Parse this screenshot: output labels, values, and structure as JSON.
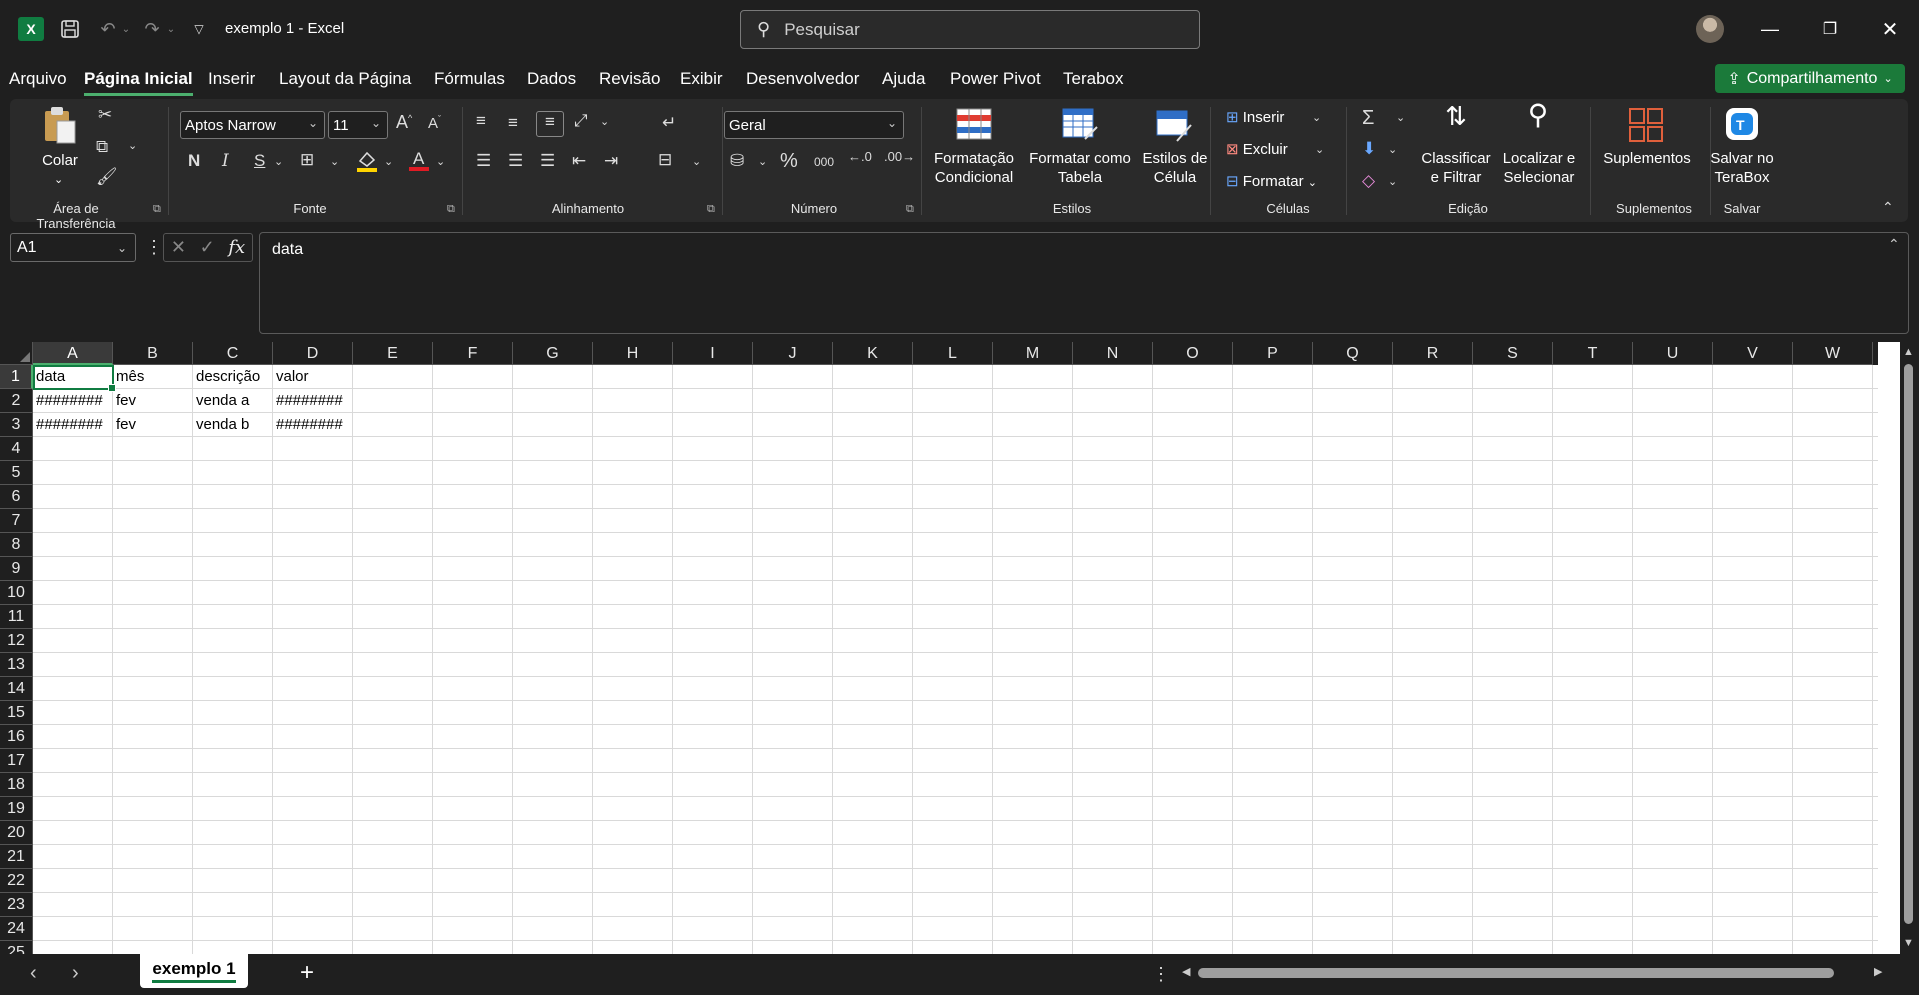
{
  "window": {
    "title": "exemplo 1  -  Excel",
    "logo_letter": "X",
    "search_placeholder": "Pesquisar"
  },
  "menu": [
    {
      "label": "Arquivo"
    },
    {
      "label": "Página Inicial",
      "active": true
    },
    {
      "label": "Inserir"
    },
    {
      "label": "Layout da Página"
    },
    {
      "label": "Fórmulas"
    },
    {
      "label": "Dados"
    },
    {
      "label": "Revisão"
    },
    {
      "label": "Exibir"
    },
    {
      "label": "Desenvolvedor"
    },
    {
      "label": "Ajuda"
    },
    {
      "label": "Power Pivot"
    },
    {
      "label": "Terabox"
    }
  ],
  "share_label": "Compartilhamento",
  "ribbon": {
    "clipboard": {
      "paste_label": "Colar",
      "group": "Área de Transferência"
    },
    "font": {
      "name": "Aptos Narrow",
      "size": "11",
      "bold": "N",
      "italic": "I",
      "underline": "S",
      "group": "Fonte"
    },
    "alignment": {
      "group": "Alinhamento"
    },
    "number": {
      "format": "Geral",
      "percent": "%",
      "thousands": "000",
      "group": "Número"
    },
    "styles": {
      "conditional_l1": "Formatação",
      "conditional_l2": "Condicional",
      "table_l1": "Formatar como",
      "table_l2": "Tabela",
      "cellstyles_l1": "Estilos de",
      "cellstyles_l2": "Célula",
      "group": "Estilos"
    },
    "cells": {
      "insert": "Inserir",
      "delete": "Excluir",
      "format": "Formatar",
      "group": "Células"
    },
    "editing": {
      "sort_l1": "Classificar",
      "sort_l2": "e Filtrar",
      "find_l1": "Localizar e",
      "find_l2": "Selecionar",
      "group": "Edição"
    },
    "addins": {
      "label": "Suplementos",
      "group": "Suplementos"
    },
    "save": {
      "l1": "Salvar no",
      "l2": "TeraBox",
      "group": "Salvar"
    }
  },
  "formula_bar": {
    "name_box": "A1",
    "content": "data"
  },
  "columns": [
    "A",
    "B",
    "C",
    "D",
    "E",
    "F",
    "G",
    "H",
    "I",
    "J",
    "K",
    "L",
    "M",
    "N",
    "O",
    "P",
    "Q",
    "R",
    "S",
    "T",
    "U",
    "V",
    "W"
  ],
  "rows": [
    "1",
    "2",
    "3",
    "4",
    "5",
    "6",
    "7",
    "8",
    "9",
    "10",
    "11",
    "12",
    "13",
    "14",
    "15",
    "16",
    "17",
    "18",
    "19",
    "20",
    "21",
    "22",
    "23",
    "24",
    "25"
  ],
  "cells": [
    [
      "data",
      "mês",
      "descrição",
      "valor"
    ],
    [
      "########",
      "fev",
      "venda a",
      "########"
    ],
    [
      "########",
      "fev",
      "venda b",
      "########"
    ]
  ],
  "sheet_tab": "exemplo 1",
  "colors": {
    "accent": "#107c41",
    "share": "#1b7a3a",
    "chrome": "#1f1f1f"
  }
}
